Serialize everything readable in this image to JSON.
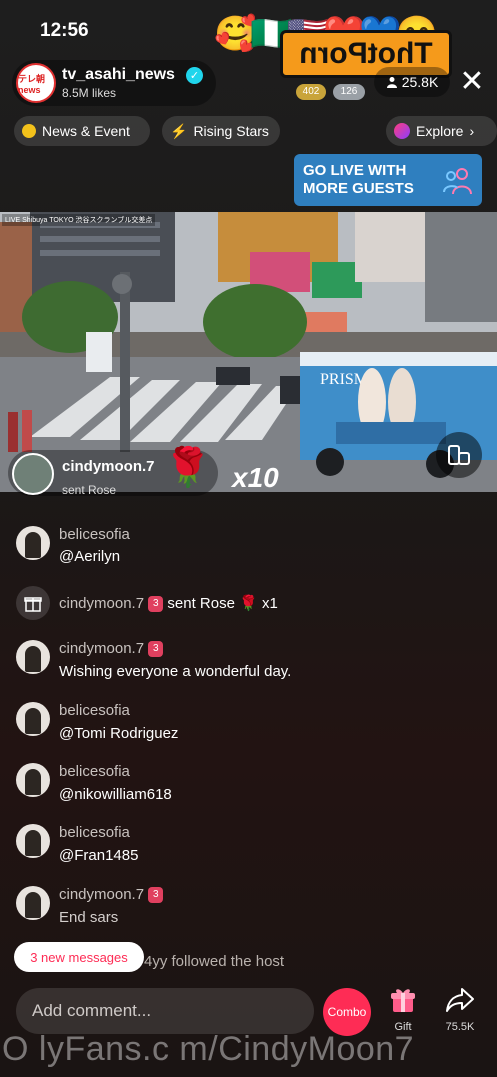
{
  "status": {
    "time": "12:56"
  },
  "overlay": {
    "emojis": "🥰🇳🇬🇺🇸❤️💙😋",
    "watermark_logo": "ThotPorn"
  },
  "host": {
    "avatar_text": "テレ朝 news",
    "name": "tv_asahi_news",
    "likes": "8.5M likes",
    "badge_a": "402",
    "badge_b": "126",
    "viewers": "25.8K"
  },
  "tabs": [
    {
      "label": "News & Event"
    },
    {
      "label": "Rising Stars"
    },
    {
      "label": "Explore"
    }
  ],
  "banner": {
    "line1": "GO LIVE WITH",
    "line2": "MORE GUESTS"
  },
  "video": {
    "caption": "LIVE Shibuya TOKYO 渋谷スクランブル交差点",
    "truck_text": "PRISM"
  },
  "gift_notice": {
    "user": "cindymoon.7",
    "action": "sent Rose",
    "count": "x10"
  },
  "chat": [
    {
      "type": "comment",
      "user": "belicesofia",
      "text": "@Aerilyn",
      "level": ""
    },
    {
      "type": "gift",
      "user": "cindymoon.7",
      "level": "3",
      "text": "sent Rose",
      "count": "x1"
    },
    {
      "type": "comment",
      "user": "cindymoon.7",
      "text": "Wishing everyone a wonderful day.",
      "level": "3"
    },
    {
      "type": "comment",
      "user": "belicesofia",
      "text": "@Tomi Rodriguez",
      "level": ""
    },
    {
      "type": "comment",
      "user": "belicesofia",
      "text": "@nikowilliam618",
      "level": ""
    },
    {
      "type": "comment",
      "user": "belicesofia",
      "text": "@Fran1485",
      "level": ""
    },
    {
      "type": "comment",
      "user": "cindymoon.7",
      "text": "End sars",
      "level": "3"
    }
  ],
  "new_messages": "3 new messages",
  "follow_notice": "4yy followed the host",
  "composer": {
    "placeholder": "Add comment...",
    "combo_label": "Combo",
    "gift_label": "Gift",
    "share_count": "75.5K"
  },
  "bottom_watermark": "O lyFans.c m/CindyMoon7",
  "colors": {
    "accent": "#fe2c55",
    "verified": "#20d5ec",
    "banner": "#2f7fbf",
    "watermark": "#f59a1b"
  }
}
